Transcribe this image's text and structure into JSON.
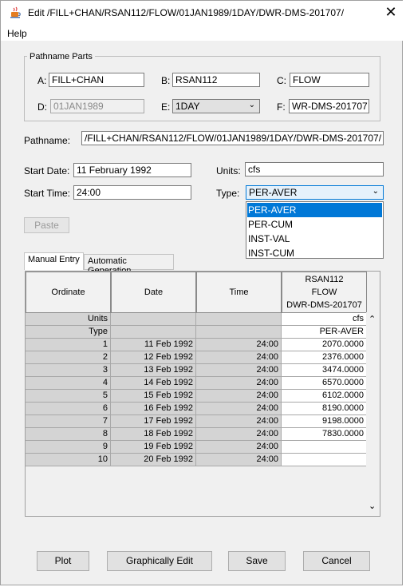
{
  "window": {
    "title": "Edit  /FILL+CHAN/RSAN112/FLOW/01JAN1989/1DAY/DWR-DMS-201707/",
    "close_glyph": "✕"
  },
  "menu": {
    "help": "Help"
  },
  "pathname_parts": {
    "group_title": "Pathname Parts",
    "a_label": "A:",
    "a_value": "FILL+CHAN",
    "b_label": "B:",
    "b_value": "RSAN112",
    "c_label": "C:",
    "c_value": "FLOW",
    "d_label": "D:",
    "d_value": "01JAN1989",
    "e_label": "E:",
    "e_value": "1DAY",
    "f_label": "F:",
    "f_value": "WR-DMS-201707"
  },
  "pathname": {
    "label": "Pathname:",
    "value": "/FILL+CHAN/RSAN112/FLOW/01JAN1989/1DAY/DWR-DMS-201707/"
  },
  "start_date": {
    "label": "Start Date:",
    "value": "11 February 1992"
  },
  "start_time": {
    "label": "Start Time:",
    "value": "24:00"
  },
  "units": {
    "label": "Units:",
    "value": "cfs"
  },
  "type": {
    "label": "Type:",
    "value": "PER-AVER",
    "options": [
      "PER-AVER",
      "PER-CUM",
      "INST-VAL",
      "INST-CUM"
    ],
    "selected_index": 0
  },
  "paste_label": "Paste",
  "tabs": {
    "manual": "Manual Entry",
    "automatic": "Automatic Generation"
  },
  "table": {
    "headers": {
      "ordinate": "Ordinate",
      "date": "Date",
      "time": "Time",
      "series_line1": "RSAN112",
      "series_line2": "FLOW",
      "series_line3": "DWR-DMS-201707"
    },
    "units_row": {
      "label": "Units",
      "value": "cfs"
    },
    "type_row": {
      "label": "Type",
      "value": "PER-AVER"
    },
    "rows": [
      {
        "ordinate": "1",
        "date": "11 Feb 1992",
        "time": "24:00",
        "value": "2070.0000"
      },
      {
        "ordinate": "2",
        "date": "12 Feb 1992",
        "time": "24:00",
        "value": "2376.0000"
      },
      {
        "ordinate": "3",
        "date": "13 Feb 1992",
        "time": "24:00",
        "value": "3474.0000"
      },
      {
        "ordinate": "4",
        "date": "14 Feb 1992",
        "time": "24:00",
        "value": "6570.0000"
      },
      {
        "ordinate": "5",
        "date": "15 Feb 1992",
        "time": "24:00",
        "value": "6102.0000"
      },
      {
        "ordinate": "6",
        "date": "16 Feb 1992",
        "time": "24:00",
        "value": "8190.0000"
      },
      {
        "ordinate": "7",
        "date": "17 Feb 1992",
        "time": "24:00",
        "value": "9198.0000"
      },
      {
        "ordinate": "8",
        "date": "18 Feb 1992",
        "time": "24:00",
        "value": "7830.0000"
      },
      {
        "ordinate": "9",
        "date": "19 Feb 1992",
        "time": "24:00",
        "value": ""
      },
      {
        "ordinate": "10",
        "date": "20 Feb 1992",
        "time": "24:00",
        "value": ""
      }
    ]
  },
  "buttons": {
    "plot": "Plot",
    "graphically_edit": "Graphically Edit",
    "save": "Save",
    "cancel": "Cancel"
  },
  "icons": {
    "app": "java-cup-icon",
    "scroll_up": "chevron-up-icon",
    "scroll_down": "chevron-down-icon",
    "combo_arrow": "chevron-down-icon"
  },
  "colors": {
    "selection": "#0078d7",
    "gray_cell": "#d4d4d4"
  }
}
